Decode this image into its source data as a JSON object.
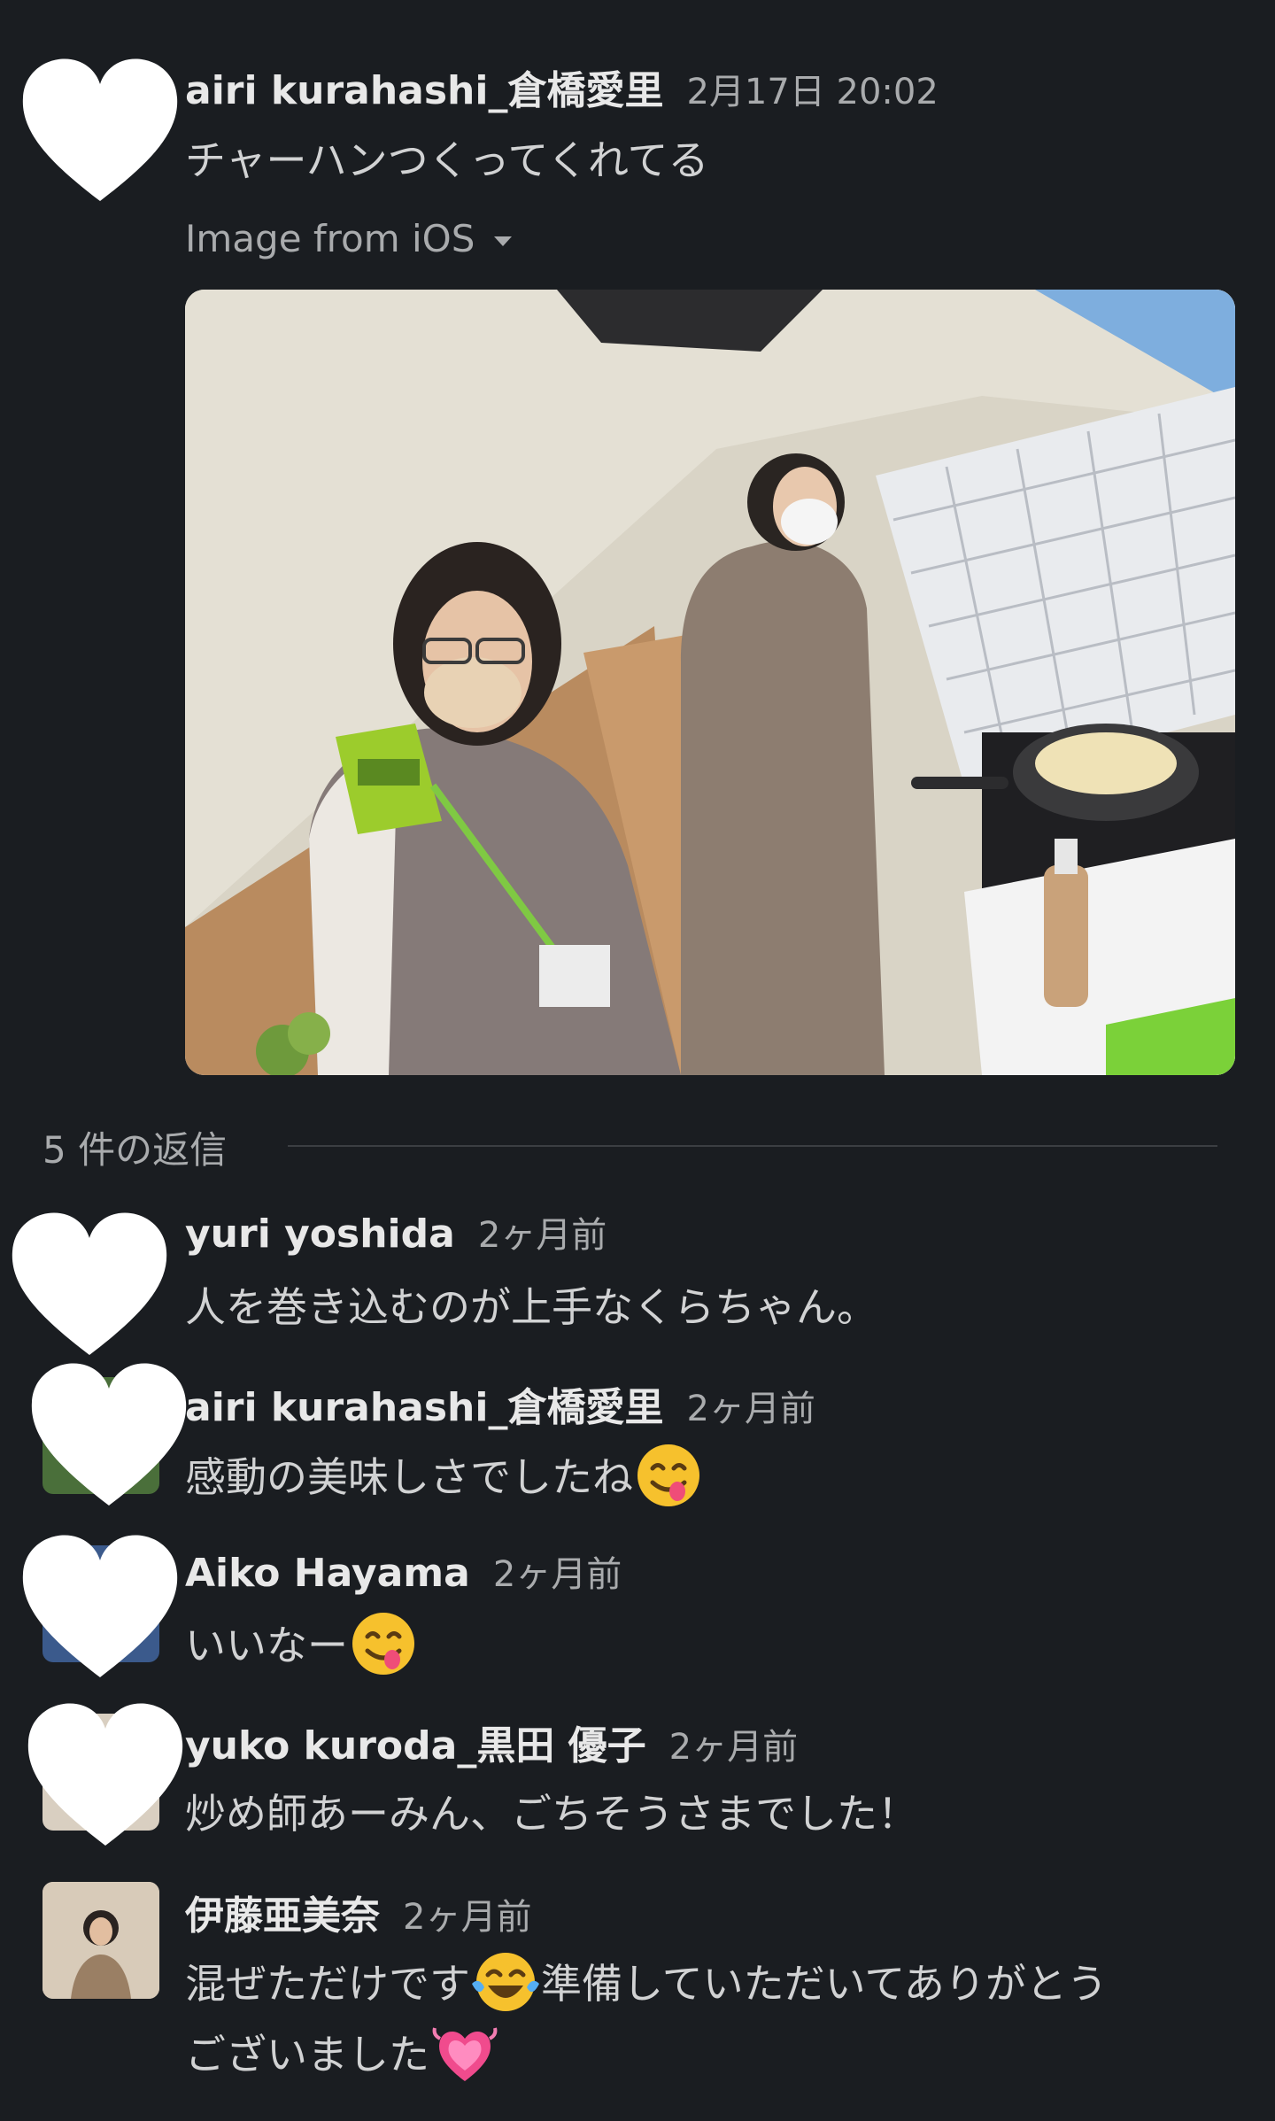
{
  "post": {
    "author": "airi kurahashi_倉橋愛里",
    "time": "2月17日 20:02",
    "text": "チャーハンつくってくれてる",
    "file_label": "Image from iOS"
  },
  "thread": {
    "reply_count_label": "5 件の返信"
  },
  "replies": [
    {
      "author": "yuri yoshida",
      "time": "2ヶ月前",
      "text": "人を巻き込むのが上手なくらちゃん。"
    },
    {
      "author": "airi kurahashi_倉橋愛里",
      "time": "2ヶ月前",
      "text": "感動の美味しさでしたね",
      "emoji": "yum-face-emoji"
    },
    {
      "author": "Aiko Hayama",
      "time": "2ヶ月前",
      "text": "いいなー",
      "emoji": "yum-face-emoji"
    },
    {
      "author": "yuko kuroda_黒田 優子",
      "time": "2ヶ月前",
      "text": "炒め師あーみん、ごちそうさまでした！"
    },
    {
      "author": "伊藤亜美奈",
      "time": "2ヶ月前",
      "text_part1": "混ぜただけです",
      "emoji1": "tears-of-joy-emoji",
      "text_part2": "準備していただいてありがとう",
      "text_line2": "ございました",
      "emoji2": "growing-heart-emoji"
    }
  ],
  "colors": {
    "background": "#1a1d21",
    "text": "#d1d2d3",
    "muted": "#a9abad"
  }
}
